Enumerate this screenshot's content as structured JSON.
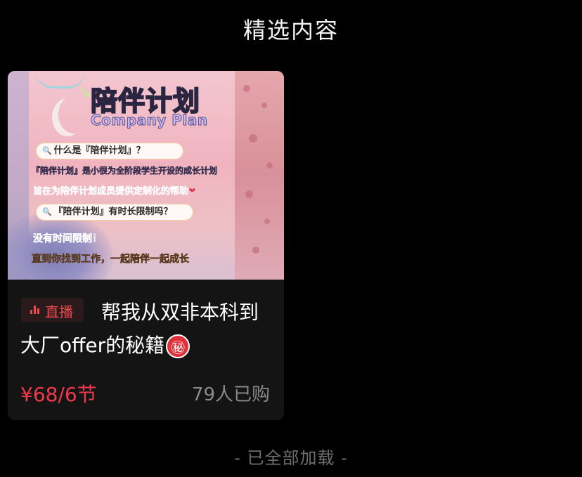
{
  "header": {
    "title": "精选内容"
  },
  "card": {
    "poster": {
      "title": "陪伴计划",
      "subtitle": "Company Plan",
      "question_1": "什么是『陪伴计划』？",
      "line_1": "『陪伴计划』是小很为全阶段学生开设的成长计划",
      "line_2": "旨在为陪伴计划成员提供定制化的帮助",
      "heart": "❤",
      "question_2": "『陪伴计划』有时长限制吗？",
      "line_3": "没有时间限制！",
      "line_4": "直到你找到工作，一起陪伴一起成长"
    },
    "live_badge": "直播",
    "title": "帮我从双非本科到大厂offer的秘籍",
    "secret_icon": "㊙",
    "price": "¥68/6节",
    "buyers": "79人已购"
  },
  "footer": {
    "text": "- 已全部加载 -"
  },
  "colors": {
    "background": "#000000",
    "card": "#141414",
    "accent": "#f0394d",
    "muted": "#8a8a8a"
  }
}
